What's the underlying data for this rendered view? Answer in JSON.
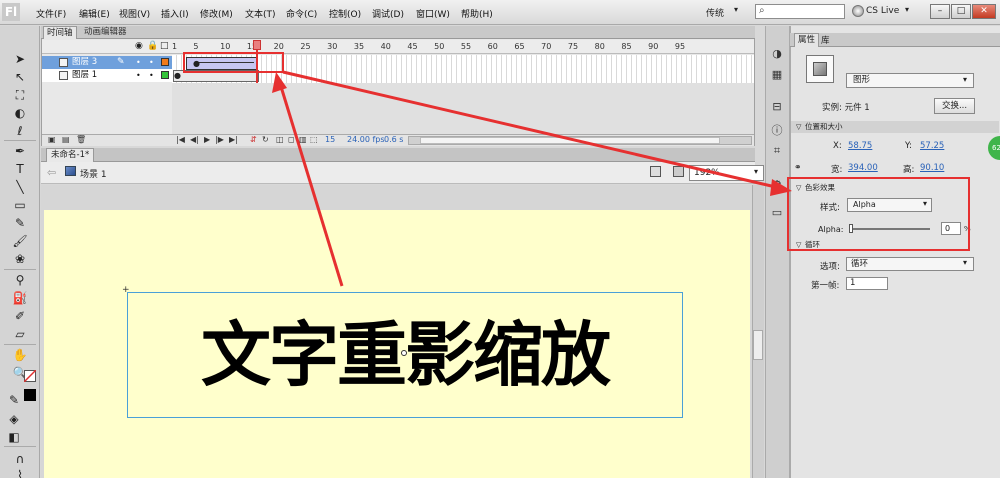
{
  "app": {
    "logo": "Fl"
  },
  "menu": [
    "文件(F)",
    "编辑(E)",
    "视图(V)",
    "插入(I)",
    "修改(M)",
    "文本(T)",
    "命令(C)",
    "控制(O)",
    "调试(D)",
    "窗口(W)",
    "帮助(H)"
  ],
  "workspace": {
    "label": "传统"
  },
  "cs_live": {
    "label": "CS Live"
  },
  "window_buttons": {
    "minimize": "–",
    "restore": "□",
    "close": "✕"
  },
  "timeline": {
    "tabs": [
      "时间轴",
      "动画编辑器"
    ],
    "frame_ticks": [
      "1",
      "5",
      "10",
      "15",
      "20",
      "25",
      "30",
      "35",
      "40",
      "45",
      "50",
      "55",
      "60",
      "65",
      "70",
      "75",
      "80",
      "85",
      "90",
      "95"
    ],
    "layers": [
      {
        "name": "图层 3",
        "color": "#f07a1a",
        "selected": true
      },
      {
        "name": "图层 1",
        "color": "#35c43a",
        "selected": false
      }
    ],
    "current_frame": "15",
    "fps": "24.00 fps",
    "time": "0.6 s"
  },
  "document": {
    "tab": "未命名-1*",
    "scene": "场景 1",
    "zoom": "192%"
  },
  "stage": {
    "text": "文字重影缩放",
    "background": "#ffffcc"
  },
  "properties": {
    "tabs": [
      "属性",
      "库"
    ],
    "type": "图形",
    "instance_label": "实例: 元件 1",
    "swap_button": "交换...",
    "position_section": "位置和大小",
    "x_label": "X:",
    "x_value": "58.75",
    "y_label": "Y:",
    "y_value": "57.25",
    "w_label": "宽:",
    "w_value": "394.00",
    "h_label": "高:",
    "h_value": "90.10",
    "color_section": "色彩效果",
    "style_label": "样式:",
    "style_value": "Alpha",
    "alpha_label": "Alpha:",
    "alpha_value": "0",
    "alpha_unit": "%",
    "loop_section": "循环",
    "options_label": "选项:",
    "options_value": "循环",
    "first_frame_label": "第一帧:",
    "first_frame_value": "1"
  },
  "badge": "62",
  "annotation_color": "#e63030"
}
